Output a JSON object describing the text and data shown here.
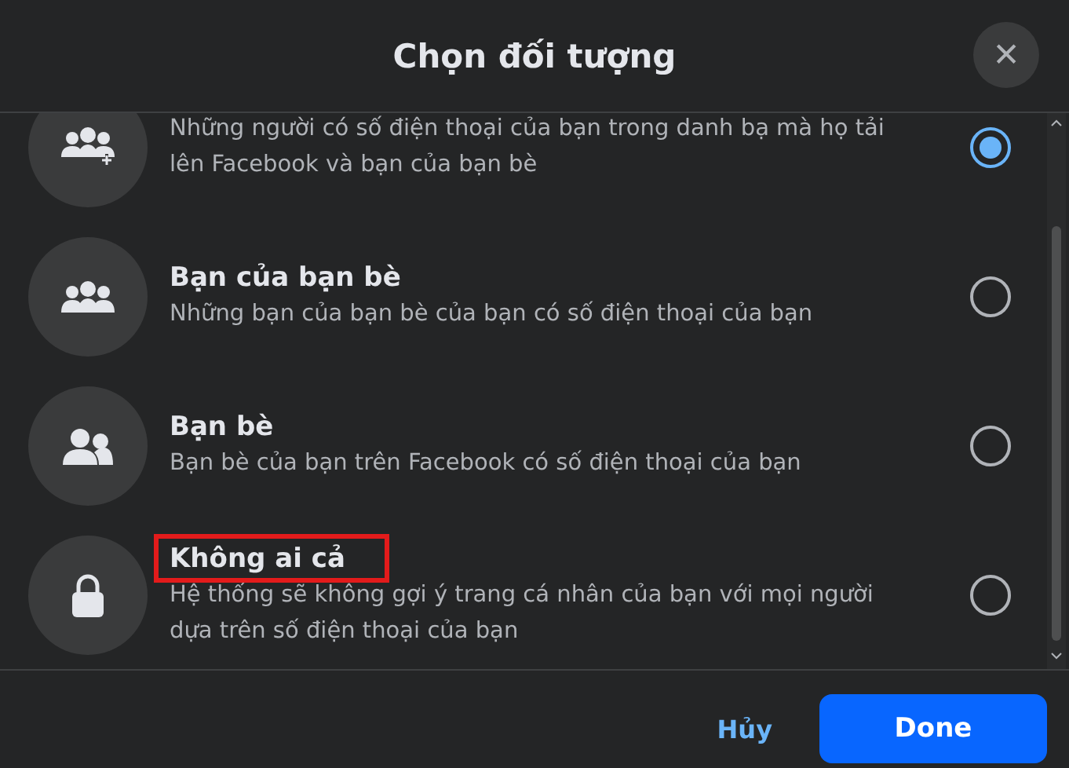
{
  "dialog": {
    "title": "Chọn đối tượng",
    "close_label": "✕"
  },
  "options": [
    {
      "kind": "group-add",
      "description": "Những người có số điện thoại của bạn trong danh bạ mà họ tải lên Facebook và bạn của bạn bè",
      "selected": true,
      "highlighted": false
    },
    {
      "kind": "group",
      "title": "Bạn của bạn bè",
      "description": "Những bạn của bạn bè của bạn có số điện thoại của bạn",
      "selected": false,
      "highlighted": false
    },
    {
      "kind": "friends",
      "title": "Bạn bè",
      "description": "Bạn bè của bạn trên Facebook có số điện thoại của bạn",
      "selected": false,
      "highlighted": false
    },
    {
      "kind": "private",
      "title": "Không ai cả",
      "description": "Hệ thống sẽ không gợi ý trang cá nhân của bạn với mọi người dựa trên số điện thoại của bạn",
      "selected": false,
      "highlighted": true
    }
  ],
  "buttons": {
    "cancel": "Hủy",
    "confirm": "Done"
  }
}
